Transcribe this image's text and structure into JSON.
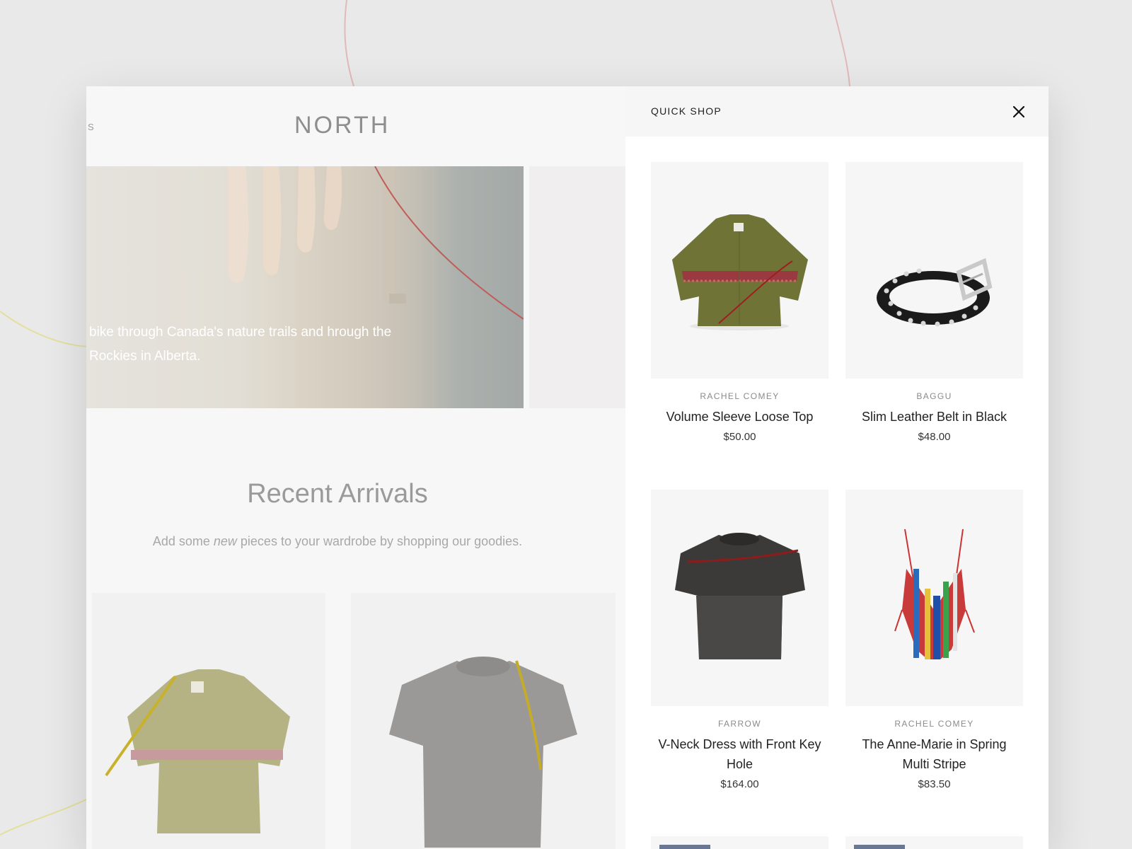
{
  "store": {
    "nav_fragment": "S",
    "logo": "NORTH",
    "hero_text": "bike through Canada's nature trails and hrough the Rockies in Alberta.",
    "arrivals_title": "Recent Arrivals",
    "arrivals_sub_before": "Add some ",
    "arrivals_sub_em": "new",
    "arrivals_sub_after": " pieces to your wardrobe by shopping our goodies."
  },
  "quick_shop": {
    "title": "QUICK SHOP",
    "close_icon": "close-icon",
    "products": [
      {
        "brand": "RACHEL COMEY",
        "name": "Volume Sleeve Loose Top",
        "price": "$50.00",
        "icon": "olive-top"
      },
      {
        "brand": "BAGGU",
        "name": "Slim Leather Belt in Black",
        "price": "$48.00",
        "icon": "studded-belt"
      },
      {
        "brand": "FARROW",
        "name": "V-Neck Dress with Front Key Hole",
        "price": "$164.00",
        "icon": "mesh-tee"
      },
      {
        "brand": "RACHEL COMEY",
        "name": "The Anne-Marie in Spring Multi Stripe",
        "price": "$83.50",
        "icon": "striped-swimsuit"
      }
    ]
  },
  "colors": {
    "accent_tag": "#6a7894",
    "deco_red": "#c23a3a",
    "deco_yellow": "#d6cf55"
  }
}
